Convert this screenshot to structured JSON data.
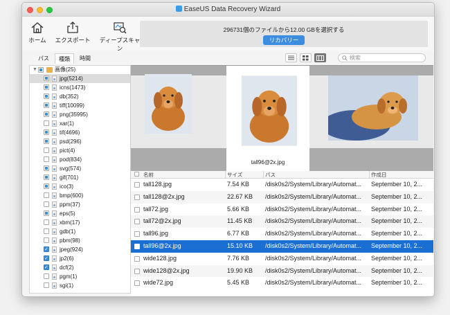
{
  "window": {
    "title": "EaseUS Data Recovery Wizard"
  },
  "toolbar": {
    "home_label": "ホーム",
    "export_label": "エクスポート",
    "deepscan_label": "ディープスキャン",
    "banner_message": "296731個のファイルから12.00 GBを選択する",
    "recover_label": "リカバリー"
  },
  "tabs": [
    {
      "label": "パス"
    },
    {
      "label": "種類"
    },
    {
      "label": "時間"
    }
  ],
  "active_tab": "種類",
  "search": {
    "placeholder": "検索"
  },
  "tree": {
    "root": {
      "label": "画像(25)"
    },
    "items": [
      {
        "label": "jpg(5214)",
        "state": "partial",
        "selected": true
      },
      {
        "label": "icns(1473)",
        "state": "partial"
      },
      {
        "label": "db(352)",
        "state": "partial"
      },
      {
        "label": "tiff(10099)",
        "state": "partial"
      },
      {
        "label": "png(35995)",
        "state": "partial"
      },
      {
        "label": "xar(1)",
        "state": "none"
      },
      {
        "label": "tif(4696)",
        "state": "partial"
      },
      {
        "label": "psd(296)",
        "state": "partial"
      },
      {
        "label": "pict(4)",
        "state": "none"
      },
      {
        "label": "pod(834)",
        "state": "none"
      },
      {
        "label": "svg(574)",
        "state": "partial"
      },
      {
        "label": "gif(701)",
        "state": "partial"
      },
      {
        "label": "ico(3)",
        "state": "partial"
      },
      {
        "label": "bmp(600)",
        "state": "none"
      },
      {
        "label": "ppm(37)",
        "state": "none"
      },
      {
        "label": "eps(5)",
        "state": "partial"
      },
      {
        "label": "xbm(17)",
        "state": "none"
      },
      {
        "label": "gdb(1)",
        "state": "none"
      },
      {
        "label": "pbm(98)",
        "state": "none"
      },
      {
        "label": "jpeg(924)",
        "state": "checked"
      },
      {
        "label": "jp2(6)",
        "state": "checked"
      },
      {
        "label": "dcf(2)",
        "state": "checked"
      },
      {
        "label": "pgm(1)",
        "state": "none"
      },
      {
        "label": "sgi(1)",
        "state": "none"
      }
    ]
  },
  "preview": {
    "selected_caption": "tall96@2x.jpg"
  },
  "file_list": {
    "headers": {
      "name": "名前",
      "size": "サイズ",
      "path": "パス",
      "created": "作成日"
    },
    "rows": [
      {
        "name": "tall128.jpg",
        "size": "7.54 KB",
        "path": "/disk0s2/System/Library/Automat...",
        "created": "September 10, 2..."
      },
      {
        "name": "tall128@2x.jpg",
        "size": "22.67 KB",
        "path": "/disk0s2/System/Library/Automat...",
        "created": "September 10, 2..."
      },
      {
        "name": "tall72.jpg",
        "size": "5.66 KB",
        "path": "/disk0s2/System/Library/Automat...",
        "created": "September 10, 2..."
      },
      {
        "name": "tall72@2x.jpg",
        "size": "11.45 KB",
        "path": "/disk0s2/System/Library/Automat...",
        "created": "September 10, 2..."
      },
      {
        "name": "tall96.jpg",
        "size": "6.77 KB",
        "path": "/disk0s2/System/Library/Automat...",
        "created": "September 10, 2..."
      },
      {
        "name": "tall96@2x.jpg",
        "size": "15.10 KB",
        "path": "/disk0s2/System/Library/Automat...",
        "created": "September 10, 2...",
        "selected": true
      },
      {
        "name": "wide128.jpg",
        "size": "7.76 KB",
        "path": "/disk0s2/System/Library/Automat...",
        "created": "September 10, 2..."
      },
      {
        "name": "wide128@2x.jpg",
        "size": "19.90 KB",
        "path": "/disk0s2/System/Library/Automat...",
        "created": "September 10, 2..."
      },
      {
        "name": "wide72.jpg",
        "size": "5.45 KB",
        "path": "/disk0s2/System/Library/Automat...",
        "created": "September 10, 2..."
      }
    ]
  },
  "colors": {
    "accent": "#1b6fd3",
    "recover_button": "#3c8de0"
  }
}
